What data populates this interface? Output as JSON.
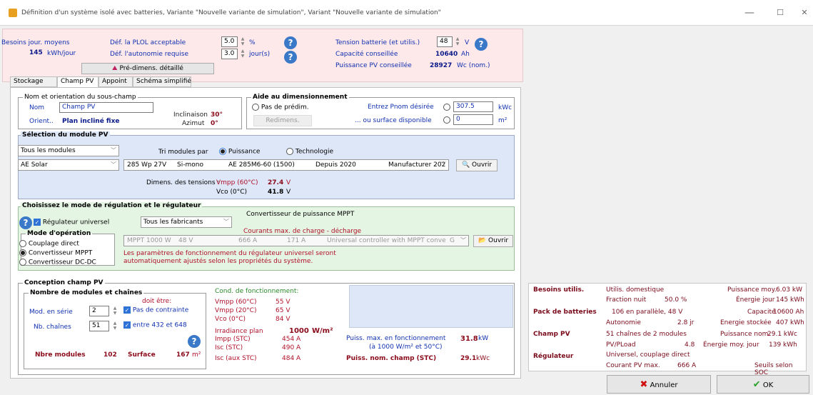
{
  "window": {
    "title": "Définition d'un système isolé avec batteries, Variante  \"Nouvelle variante de simulation\", Variant  \"Nouvelle variante de simulation\"",
    "minimize": "—",
    "maximize": "☐",
    "close": "✕"
  },
  "summary": {
    "besoins_label": "Besoins jour. moyens",
    "besoins_value": "145",
    "besoins_unit": "kWh/jour",
    "plol_label": "Déf. la PLOL acceptable",
    "plol_value": "5.0",
    "plol_unit": "%",
    "autonomie_label": "Déf. l'autonomie requise",
    "autonomie_value": "3.0",
    "autonomie_unit": "jour(s)",
    "predim_button": "Pré-dimens. détaillé",
    "tension_label": "Tension batterie (et utilis.)",
    "tension_value": "48",
    "tension_unit": "V",
    "capacite_label": "Capacité conseillée",
    "capacite_value": "10640",
    "capacite_unit": "Ah",
    "puissance_label": "Puissance PV conseillée",
    "puissance_value": "28927",
    "puissance_unit": "Wc (nom.)"
  },
  "tabs": [
    "Stockage",
    "Champ PV",
    "Appoint",
    "Schéma simplifié"
  ],
  "subfield": {
    "legend": "Nom et orientation du sous-champ",
    "nom_label": "Nom",
    "nom_value": "Champ PV",
    "orient_label": "Orient..",
    "orient_value": "Plan incliné fixe",
    "inclinaison_label": "Inclinaison",
    "inclinaison_value": "30°",
    "azimut_label": "Azimut",
    "azimut_value": "0°"
  },
  "aide": {
    "legend": "Aide au dimensionnement",
    "pas_label": "Pas de prédim.",
    "pnom_label": "Entrez Pnom désirée",
    "pnom_value": "307.5",
    "pnom_unit": "kWc",
    "surface_label": "... ou surface disponible",
    "surface_value": "0",
    "surface_unit": "m²",
    "redimens_button": "Redimens."
  },
  "module": {
    "legend": "Sélection du module PV",
    "filter": "Tous les modules",
    "tri_label": "Tri modules par",
    "opt_puissance": "Puissance",
    "opt_technologie": "Technologie",
    "manufacturer": "AE Solar",
    "power": "285 Wp 27V",
    "tech": "Si-mono",
    "model": "AE 285M6-60 (1500)",
    "since": "Depuis 2020",
    "source": "Manufacturer 202",
    "ouvrir": "Ouvrir",
    "dimens_label": "Dimens. des tensions :",
    "vmpp_label": "Vmpp (60°C)",
    "vmpp_value": "27.4",
    "vmpp_unit": "V",
    "vco_label": "Vco (0°C)",
    "vco_value": "41.8",
    "vco_unit": "V"
  },
  "regulation": {
    "legend": "Choisissez le mode de régulation et le régulateur",
    "universel_label": "Régulateur universel",
    "fabricants": "Tous les fabricants",
    "convertisseur_title": "Convertisseur de puissance MPPT",
    "courants_title": "Courants max. de charge - décharge",
    "mode_legend": "Mode d'opération",
    "mode_direct": "Couplage direct",
    "mode_mppt": "Convertisseur MPPT",
    "mode_dcdc": "Convertisseur DC-DC",
    "reg_power": "MPPT 1000 W",
    "reg_voltage": "48 V",
    "reg_current1": "666 A",
    "reg_current2": "171 A",
    "reg_desc": "Universal controller with MPPT conve",
    "reg_g": "G",
    "ouvrir": "Ouvrir",
    "note1": "Les paramètres de fonctionnement du régulateur universel seront",
    "note2": "automatiquement ajustés selon les propriétés du système."
  },
  "conception": {
    "legend": "Conception champ PV",
    "nb_legend": "Nombre de modules et chaînes",
    "doit_etre": "doit être:",
    "serie_label": "Mod. en série",
    "serie_value": "2",
    "pas_contrainte": "Pas de contrainte",
    "chaines_label": "Nb. chaînes",
    "chaines_value": "51",
    "entre": "entre 432 et 648",
    "nbre_label": "Nbre modules",
    "nbre_value": "102",
    "surface_label": "Surface",
    "surface_value": "167",
    "surface_unit": "m²",
    "cond_title": "Cond. de fonctionnement:",
    "vmpp60_label": "Vmpp (60°C)",
    "vmpp60_value": "55 V",
    "vmpp20_label": "Vmpp (20°C)",
    "vmpp20_value": "65 V",
    "vco0_label": "Vco (0°C)",
    "vco0_value": "84 V",
    "irr_label": "Irradiance plan",
    "irr_value": "1000",
    "irr_unit": "W/m²",
    "impp_label": "Impp (STC)",
    "impp_value": "454 A",
    "isc_label": "Isc (STC)",
    "isc_value": "490 A",
    "iscaux_label": "Isc (aux STC)",
    "iscaux_value": "484 A",
    "pmax_label": "Puiss. max. en fonctionnement",
    "pmax_value": "31.8",
    "pmax_unit": "kW",
    "pmax_cond": "(à 1000 W/m² et 50°C)",
    "pnom_label": "Puiss. nom. champ (STC)",
    "pnom_value": "29.1",
    "pnom_unit": "kWc"
  },
  "results": {
    "besoins_h": "Besoins utilis.",
    "besoins_v": "Utilis. domestique",
    "pmoy_label": "Puissance moy.",
    "pmoy_value": "6.03 kW",
    "fraction_label": "Fraction nuit",
    "fraction_value": "50.0 %",
    "ejour_label": "Énergie jour",
    "ejour_value": "145 kWh",
    "pack_h": "Pack de batteries",
    "pack_v": "106 en parallèle, 48 V",
    "capacite_label": "Capacité",
    "capacite_value": "10600 Ah",
    "autonomie_label": "Autonomie",
    "autonomie_value": "2.8 jr",
    "estockee_label": "Energie stockée",
    "estockee_value": "407 kWh",
    "champ_h": "Champ PV",
    "champ_v": "51 chaînes de 2 modules",
    "pnom_label": "Puissance nom.",
    "pnom_value": "29.1 kWc",
    "pvload_label": "PV/PLoad",
    "pvload_value": "4.8",
    "emoy_label": "Énergie moy. jour",
    "emoy_value": "139 kWh",
    "reg_h": "Régulateur",
    "reg_v": "Universel, couplage direct",
    "courant_label": "Courant PV max.",
    "courant_value": "666 A",
    "seuils": "Seuils selon SOC"
  },
  "buttons": {
    "annuler": "Annuler",
    "ok": "OK"
  },
  "colors": {
    "pink": "#fde8ea",
    "blue_panel": "#dde7f7",
    "green_panel": "#e5f5e3",
    "accent": "#1030b0"
  }
}
